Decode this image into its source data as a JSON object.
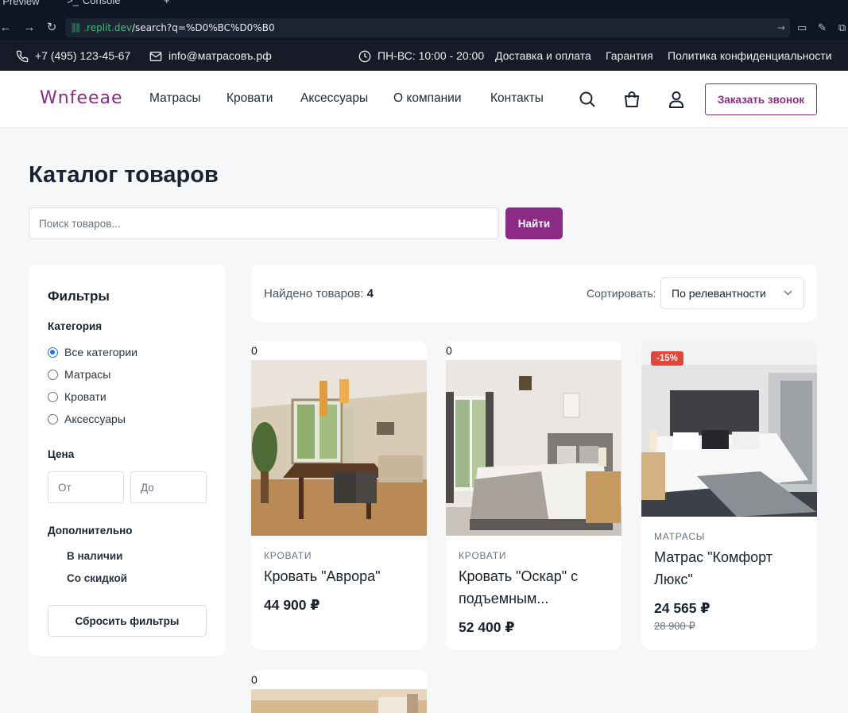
{
  "browser": {
    "tab_preview": "Preview",
    "tab_console": "Console",
    "tab_new": "+",
    "url_host": ".replit.dev",
    "url_path": "/search?q=%D0%BC%D0%B0"
  },
  "topbar": {
    "phone": "+7 (495) 123-45-67",
    "email": "info@матрасовъ.рф",
    "hours": "ПН-ВС: 10:00 - 20:00",
    "links": [
      "Доставка и оплата",
      "Гарантия",
      "Политика конфиденциальности"
    ]
  },
  "header": {
    "logo_text": "Wnfeeae",
    "nav": [
      "Матрасы",
      "Кровати",
      "Аксессуары",
      "О компании",
      "Контакты"
    ],
    "callback_label": "Заказать звонок"
  },
  "page": {
    "title": "Каталог товаров",
    "search_placeholder": "Поиск товаров...",
    "search_button": "Найти"
  },
  "filters": {
    "title": "Фильтры",
    "category_label": "Категория",
    "categories": [
      "Все категории",
      "Матрасы",
      "Кровати",
      "Аксессуары"
    ],
    "selected_category": "Все категории",
    "price_label": "Цена",
    "price_from_placeholder": "От",
    "price_to_placeholder": "До",
    "extra_label": "Дополнительно",
    "extra_options": [
      "В наличии",
      "Со скидкой"
    ],
    "reset_label": "Сбросить фильтры"
  },
  "results": {
    "found_label": "Найдено товаров:",
    "found_count": "4",
    "sort_label": "Сортировать:",
    "sort_value": "По релевантности"
  },
  "products": [
    {
      "zero": "0",
      "category": "КРОВАТИ",
      "name": "Кровать \"Аврора\"",
      "price": "44 900 ₽",
      "image": "dining-room-photo"
    },
    {
      "zero": "0",
      "category": "КРОВАТИ",
      "name": "Кровать \"Оскар\" с подъемным...",
      "price": "52 400 ₽",
      "image": "bedroom-photo"
    },
    {
      "category": "МАТРАСЫ",
      "name": "Матрас \"Комфорт Люкс\"",
      "price": "24 565 ₽",
      "old_price": "28 900 ₽",
      "badge": "-15%",
      "image": "hotel-bed-photo"
    },
    {
      "zero": "0",
      "image": "room-photo"
    }
  ],
  "colors": {
    "brand": "#8c2b84",
    "topbar_bg": "#161b27",
    "page_bg": "#f6f7f9",
    "badge": "#e0463a"
  }
}
